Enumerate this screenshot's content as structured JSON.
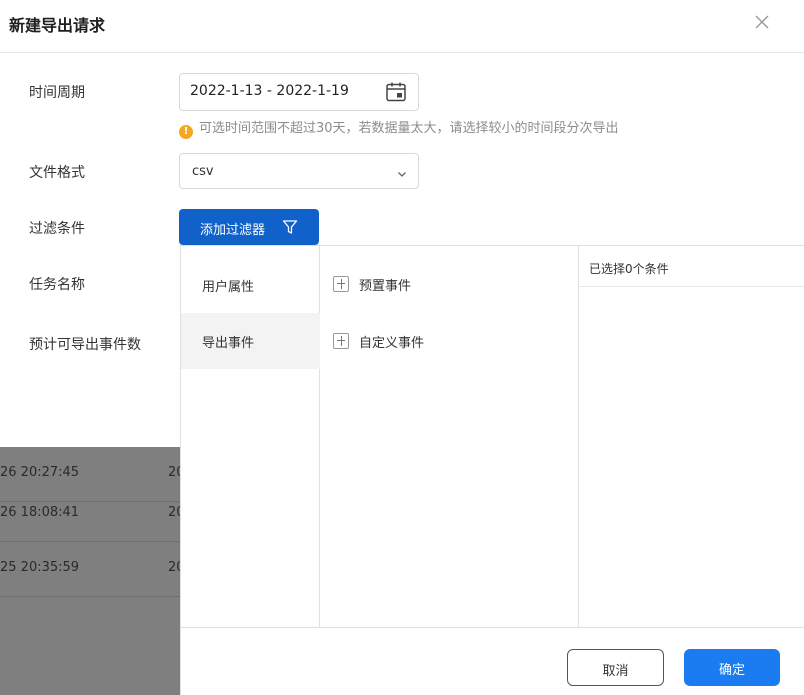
{
  "modal": {
    "title": "新建导出请求",
    "close_icon": "close-icon"
  },
  "form": {
    "time_period_label": "时间周期",
    "date_range_value": "2022-1-13 - 2022-1-19",
    "calendar_icon": "calendar-icon",
    "hint_text": "可选时间范围不超过30天，若数据量太大，请选择较小的时间段分次导出",
    "file_format_label": "文件格式",
    "file_format_value": "csv",
    "filter_label": "过滤条件",
    "add_filter_button": "添加过滤器",
    "task_name_label": "任务名称",
    "estimated_events_label": "预计可导出事件数"
  },
  "filter_panel": {
    "categories": [
      {
        "label": "用户属性",
        "active": false
      },
      {
        "label": "导出事件",
        "active": true
      }
    ],
    "events": [
      {
        "label": "预置事件"
      },
      {
        "label": "自定义事件"
      }
    ],
    "selected_header": "已选择0个条件",
    "cancel_button": "取消",
    "confirm_button": "确定"
  },
  "background_rows": [
    {
      "time": "26 20:27:45",
      "col2": "20"
    },
    {
      "time": "26 18:08:41",
      "col2": "20"
    },
    {
      "time": "25 20:35:59",
      "col2": "20"
    }
  ],
  "colors": {
    "primary": "#1061c9",
    "confirm": "#1a7cf0",
    "warning": "#f5a623",
    "overlay": "#7f7f7f"
  }
}
